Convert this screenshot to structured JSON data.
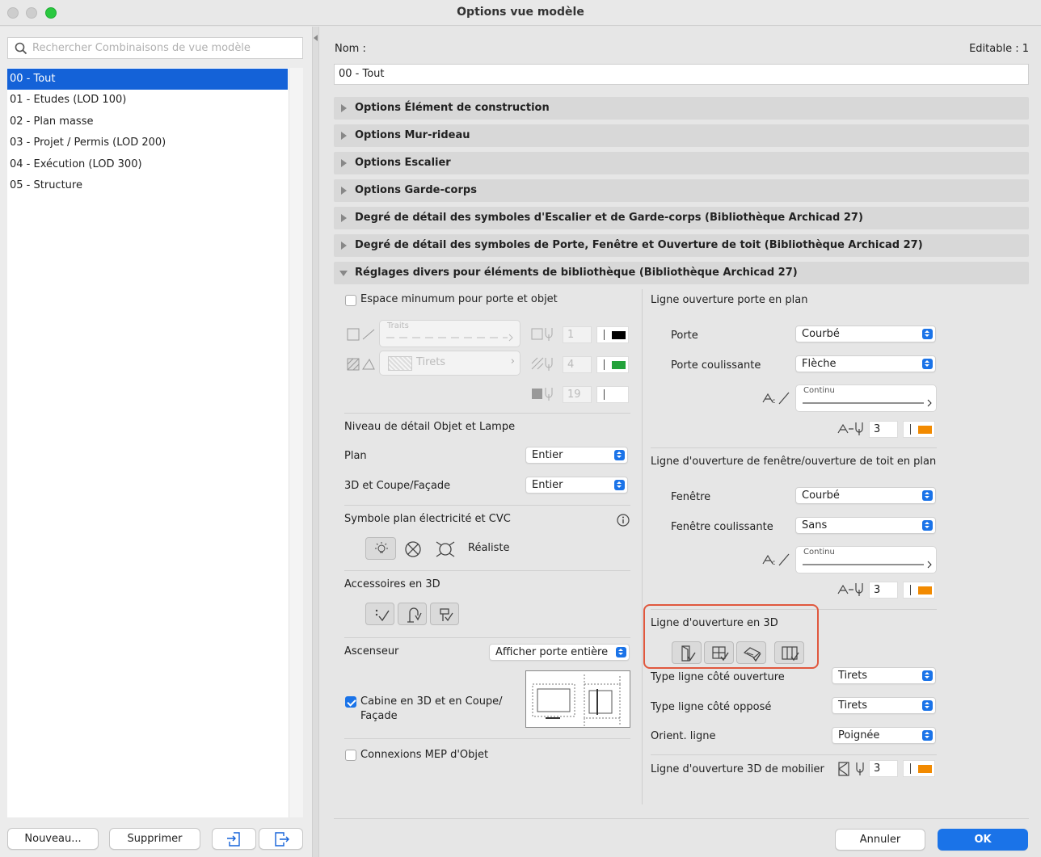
{
  "window": {
    "title": "Options vue modèle"
  },
  "search": {
    "placeholder": "Rechercher Combinaisons de vue modèle"
  },
  "list": {
    "items": [
      "00 - Tout",
      "01 - Etudes (LOD 100)",
      "02 - Plan masse",
      "03 - Projet / Permis (LOD 200)",
      "04 - Exécution (LOD 300)",
      "05 - Structure"
    ],
    "selected_index": 0
  },
  "left_buttons": {
    "new": "Nouveau...",
    "delete": "Supprimer"
  },
  "name": {
    "label": "Nom :",
    "value": "00 - Tout",
    "editable": "Editable : 1"
  },
  "sections": [
    "Options Élément de construction",
    "Options Mur-rideau",
    "Options Escalier",
    "Options Garde-corps",
    "Degré de détail des symboles d'Escalier et de Garde-corps (Bibliothèque Archicad 27)",
    "Degré de détail des symboles de Porte, Fenêtre et Ouverture de toit (Bibliothèque Archicad 27)",
    "Réglages divers pour éléments de bibliothèque (Bibliothèque Archicad 27)"
  ],
  "left_col": {
    "espace": "Espace minumum pour porte et objet",
    "traits": "Traits",
    "tirets": "Tirets",
    "pen1": "1",
    "pen2": "4",
    "pen3": "19",
    "niveau": "Niveau de détail Objet et Lampe",
    "plan": "Plan",
    "plan_val": "Entier",
    "coupe": "3D et Coupe/Façade",
    "coupe_val": "Entier",
    "symbole": "Symbole plan électricité et CVC",
    "realiste": "Réaliste",
    "accessoires": "Accessoires en 3D",
    "ascenseur": "Ascenseur",
    "ascenseur_val": "Afficher porte entière",
    "cabine1": "Cabine en 3D et en Coupe/",
    "cabine2": "Façade",
    "mep": "Connexions MEP d'Objet"
  },
  "right_col": {
    "porte_title": "Ligne ouverture porte en plan",
    "porte": "Porte",
    "porte_val": "Courbé",
    "porte_coul": "Porte coulissante",
    "porte_coul_val": "Flèche",
    "continu": "Continu",
    "pen_a": "3",
    "fen_title": "Ligne d'ouverture de fenêtre/ouverture de toit en plan",
    "fenetre": "Fenêtre",
    "fenetre_val": "Courbé",
    "fen_coul": "Fenêtre coulissante",
    "fen_coul_val": "Sans",
    "continu2": "Continu",
    "pen_b": "3",
    "l3d_title": "Ligne d'ouverture en 3D",
    "type_ouv": "Type ligne côté ouverture",
    "type_ouv_val": "Tirets",
    "type_opp": "Type ligne côté opposé",
    "type_opp_val": "Tirets",
    "orient": "Orient. ligne",
    "orient_val": "Poignée",
    "mobilier": "Ligne d'ouverture 3D de mobilier",
    "pen_c": "3"
  },
  "footer": {
    "cancel": "Annuler",
    "ok": "OK"
  },
  "colors": {
    "accent": "#1462d8",
    "orange": "#f28a00",
    "green": "#22a23a"
  }
}
